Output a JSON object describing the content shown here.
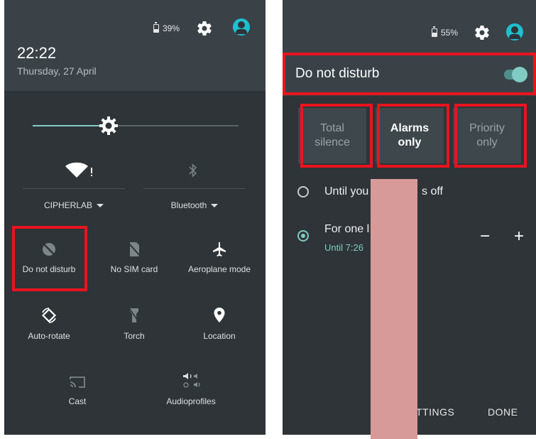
{
  "left": {
    "status": {
      "battery_pct": "39%"
    },
    "clock": "22:22",
    "date": "Thursday, 27 April",
    "brightness_level": 0.38,
    "wifi_label": "CIPHERLAB",
    "bluetooth_label": "Bluetooth",
    "tiles": [
      {
        "id": "dnd",
        "label": "Do not disturb",
        "icon": "dnd-icon"
      },
      {
        "id": "sim",
        "label": "No SIM card",
        "icon": "no-sim-icon"
      },
      {
        "id": "plane",
        "label": "Aeroplane mode",
        "icon": "airplane-icon"
      },
      {
        "id": "rotate",
        "label": "Auto-rotate",
        "icon": "auto-rotate-icon"
      },
      {
        "id": "torch",
        "label": "Torch",
        "icon": "torch-icon"
      },
      {
        "id": "location",
        "label": "Location",
        "icon": "location-icon"
      },
      {
        "id": "cast",
        "label": "Cast",
        "icon": "cast-icon"
      },
      {
        "id": "audio",
        "label": "Audioprofiles",
        "icon": "audioprofiles-icon"
      }
    ]
  },
  "right": {
    "status": {
      "battery_pct": "55%"
    },
    "title": "Do not disturb",
    "toggle_on": true,
    "segments": [
      {
        "line1": "Total",
        "line2": "silence",
        "selected": false
      },
      {
        "line1": "Alarms",
        "line2": "only",
        "selected": true
      },
      {
        "line1": "Priority",
        "line2": "only",
        "selected": false
      }
    ],
    "option1": {
      "left": "Until you",
      "right": "s off"
    },
    "option2": {
      "title": "For one l",
      "sub": "Until 7:26"
    },
    "minus": "−",
    "plus": "+",
    "settings_btn": "TTINGS",
    "done_btn": "DONE"
  },
  "colors": {
    "highlight": "#e8141e",
    "accent": "#80cbc4",
    "avatar": "#1ec0d0",
    "redaction": "#d89999"
  }
}
